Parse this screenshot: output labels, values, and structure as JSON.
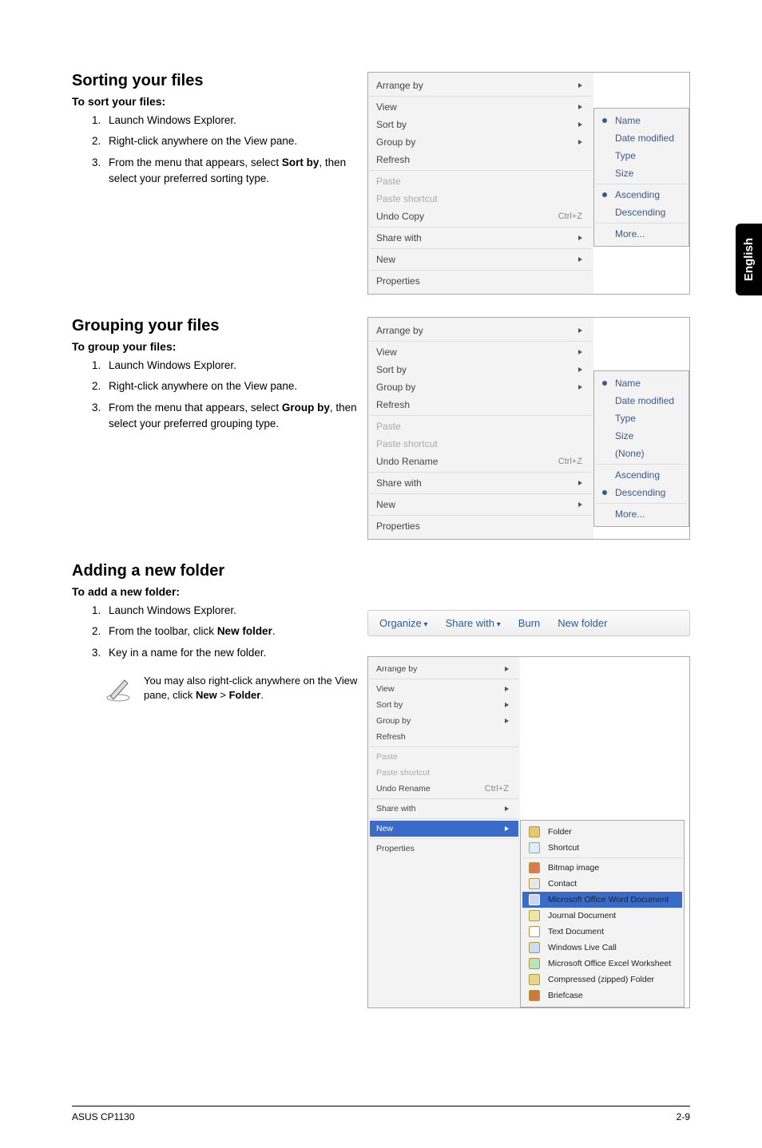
{
  "english_tab": "English",
  "section1": {
    "heading": "Sorting your files",
    "subhead": "To sort your files:",
    "step1": "Launch Windows Explorer.",
    "step2": "Right-click anywhere on the View pane.",
    "step3_a": "From the menu that appears, select ",
    "step3_b": "Sort by",
    "step3_c": ", then select your preferred sorting type."
  },
  "section2": {
    "heading": "Grouping your files",
    "subhead": "To group your files:",
    "step1": "Launch Windows Explorer.",
    "step2": "Right-click anywhere on the View pane.",
    "step3_a": "From the menu that appears, select ",
    "step3_b": "Group by",
    "step3_c": ", then select your preferred grouping type."
  },
  "section3": {
    "heading": "Adding a new folder",
    "subhead": "To add a new folder:",
    "step1": "Launch Windows Explorer.",
    "step2_a": "From the toolbar, click ",
    "step2_b": "New folder",
    "step2_c": ".",
    "step3": "Key in a name for the new folder.",
    "note_a": "You may also right-click anywhere on the View pane, click ",
    "note_b": "New",
    "note_c": " > ",
    "note_d": "Folder",
    "note_e": "."
  },
  "menu_sort": {
    "arrange_by": "Arrange by",
    "view": "View",
    "sort_by": "Sort by",
    "group_by": "Group by",
    "refresh": "Refresh",
    "paste": "Paste",
    "paste_shortcut": "Paste shortcut",
    "undo_copy": "Undo Copy",
    "undo_shortcut": "Ctrl+Z",
    "share_with": "Share with",
    "new": "New",
    "properties": "Properties",
    "sub": {
      "name": "Name",
      "date_modified": "Date modified",
      "type": "Type",
      "size": "Size",
      "ascending": "Ascending",
      "descending": "Descending",
      "more": "More..."
    }
  },
  "menu_group": {
    "arrange_by": "Arrange by",
    "view": "View",
    "sort_by": "Sort by",
    "group_by": "Group by",
    "refresh": "Refresh",
    "paste": "Paste",
    "paste_shortcut": "Paste shortcut",
    "undo_rename": "Undo Rename",
    "undo_shortcut": "Ctrl+Z",
    "share_with": "Share with",
    "new": "New",
    "properties": "Properties",
    "sub": {
      "name": "Name",
      "date_modified": "Date modified",
      "type": "Type",
      "size": "Size",
      "none": "(None)",
      "ascending": "Ascending",
      "descending": "Descending",
      "more": "More..."
    }
  },
  "toolbar": {
    "organize": "Organize",
    "share_with": "Share with",
    "burn": "Burn",
    "new_folder": "New folder"
  },
  "menu_new": {
    "arrange_by": "Arrange by",
    "view": "View",
    "sort_by": "Sort by",
    "group_by": "Group by",
    "refresh": "Refresh",
    "paste": "Paste",
    "paste_shortcut": "Paste shortcut",
    "undo_rename": "Undo Rename",
    "undo_shortcut": "Ctrl+Z",
    "share_with": "Share with",
    "new": "New",
    "properties": "Properties",
    "sub": {
      "folder": "Folder",
      "shortcut": "Shortcut",
      "bitmap": "Bitmap image",
      "contact": "Contact",
      "word": "Microsoft Office Word Document",
      "journal": "Journal Document",
      "text": "Text Document",
      "live_call": "Windows Live Call",
      "excel": "Microsoft Office Excel Worksheet",
      "zip": "Compressed (zipped) Folder",
      "briefcase": "Briefcase"
    }
  },
  "footer": {
    "left": "ASUS CP1130",
    "right": "2-9"
  }
}
